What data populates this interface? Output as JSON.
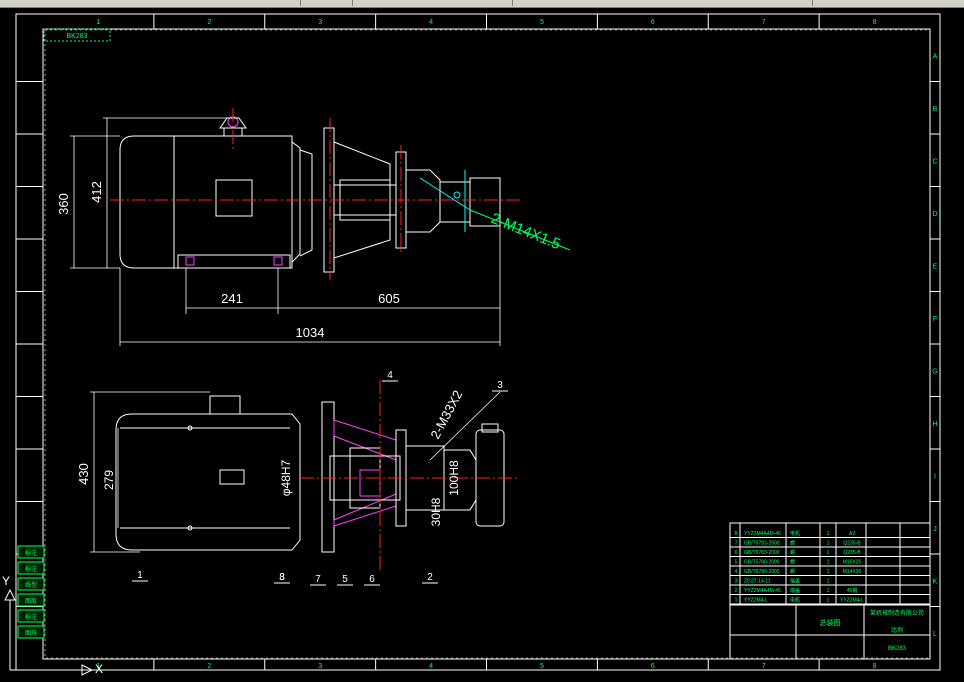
{
  "sheet": {
    "col_labels": [
      "1",
      "2",
      "3",
      "4",
      "5",
      "6",
      "7",
      "8"
    ],
    "row_labels": [
      "A",
      "B",
      "C",
      "D",
      "E",
      "F",
      "G",
      "H",
      "I",
      "J",
      "K",
      "L"
    ],
    "drawing_number": "BK283"
  },
  "views": {
    "front": {
      "dims": {
        "height_overall": "360",
        "height_inner": "412",
        "base_left": "241",
        "base_right": "605",
        "length": "1034"
      },
      "callout": "2-M14X1.5"
    },
    "section": {
      "dims": {
        "height_overall": "430",
        "height_inner": "279",
        "bore": "φ48H7",
        "shaft": "100H8",
        "hub": "30H8"
      },
      "callout": "2-M33X2",
      "items": [
        "1",
        "2",
        "3",
        "4",
        "5",
        "6",
        "7",
        "8",
        "3"
      ]
    }
  },
  "title_block": {
    "parts": [
      {
        "no": "8",
        "code": "YYZ2M4A4M-45",
        "name": "电机",
        "qty": "1",
        "mat": "A3"
      },
      {
        "no": "7",
        "code": "GB/T5783-2000",
        "name": "螺",
        "qty": "1",
        "mat": "Q235-B"
      },
      {
        "no": "6",
        "code": "GB/T5783-2000",
        "name": "螺",
        "qty": "1",
        "mat": "Q235-B"
      },
      {
        "no": "5",
        "code": "GB/T5780-2000",
        "name": "螺",
        "qty": "1",
        "mat": "M16X25"
      },
      {
        "no": "4",
        "code": "GB/T5780-2000",
        "name": "螺",
        "qty": "1",
        "mat": "M14X30"
      },
      {
        "no": "3",
        "code": "ZG27-14-11",
        "name": "端盖",
        "qty": "1",
        "mat": ""
      },
      {
        "no": "2",
        "code": "YYZ2M4A4M-45",
        "name": "端盖",
        "qty": "1",
        "mat": "45钢"
      },
      {
        "no": "1",
        "code": "YYZ2M4-L",
        "name": "电机",
        "qty": "1",
        "mat": "YYZ2M4-L"
      }
    ],
    "title": "总装图",
    "company": "某机械制造有限公司",
    "drawing_no": "BK283",
    "scale": "比例"
  },
  "toolbar_labels": [
    "标注",
    "标注",
    "线型",
    "图层",
    "标注",
    "图块"
  ]
}
